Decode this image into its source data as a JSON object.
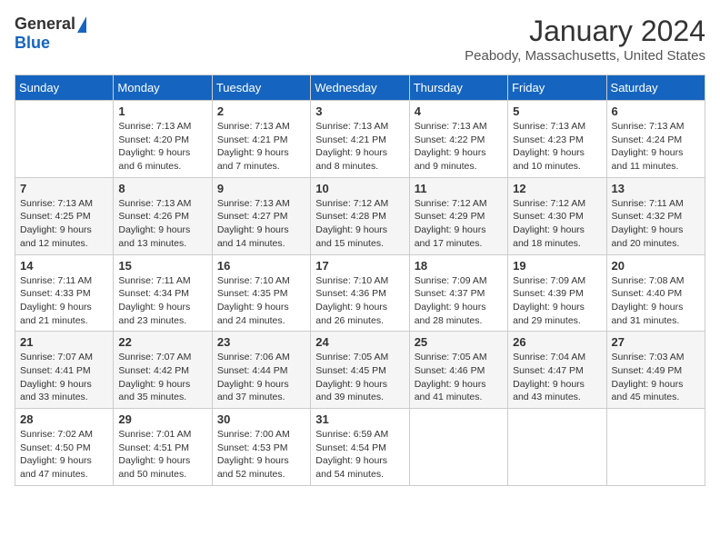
{
  "logo": {
    "general": "General",
    "blue": "Blue"
  },
  "header": {
    "title": "January 2024",
    "location": "Peabody, Massachusetts, United States"
  },
  "weekdays": [
    "Sunday",
    "Monday",
    "Tuesday",
    "Wednesday",
    "Thursday",
    "Friday",
    "Saturday"
  ],
  "weeks": [
    [
      {
        "day": "",
        "sunrise": "",
        "sunset": "",
        "daylight": ""
      },
      {
        "day": "1",
        "sunrise": "Sunrise: 7:13 AM",
        "sunset": "Sunset: 4:20 PM",
        "daylight": "Daylight: 9 hours and 6 minutes."
      },
      {
        "day": "2",
        "sunrise": "Sunrise: 7:13 AM",
        "sunset": "Sunset: 4:21 PM",
        "daylight": "Daylight: 9 hours and 7 minutes."
      },
      {
        "day": "3",
        "sunrise": "Sunrise: 7:13 AM",
        "sunset": "Sunset: 4:21 PM",
        "daylight": "Daylight: 9 hours and 8 minutes."
      },
      {
        "day": "4",
        "sunrise": "Sunrise: 7:13 AM",
        "sunset": "Sunset: 4:22 PM",
        "daylight": "Daylight: 9 hours and 9 minutes."
      },
      {
        "day": "5",
        "sunrise": "Sunrise: 7:13 AM",
        "sunset": "Sunset: 4:23 PM",
        "daylight": "Daylight: 9 hours and 10 minutes."
      },
      {
        "day": "6",
        "sunrise": "Sunrise: 7:13 AM",
        "sunset": "Sunset: 4:24 PM",
        "daylight": "Daylight: 9 hours and 11 minutes."
      }
    ],
    [
      {
        "day": "7",
        "sunrise": "Sunrise: 7:13 AM",
        "sunset": "Sunset: 4:25 PM",
        "daylight": "Daylight: 9 hours and 12 minutes."
      },
      {
        "day": "8",
        "sunrise": "Sunrise: 7:13 AM",
        "sunset": "Sunset: 4:26 PM",
        "daylight": "Daylight: 9 hours and 13 minutes."
      },
      {
        "day": "9",
        "sunrise": "Sunrise: 7:13 AM",
        "sunset": "Sunset: 4:27 PM",
        "daylight": "Daylight: 9 hours and 14 minutes."
      },
      {
        "day": "10",
        "sunrise": "Sunrise: 7:12 AM",
        "sunset": "Sunset: 4:28 PM",
        "daylight": "Daylight: 9 hours and 15 minutes."
      },
      {
        "day": "11",
        "sunrise": "Sunrise: 7:12 AM",
        "sunset": "Sunset: 4:29 PM",
        "daylight": "Daylight: 9 hours and 17 minutes."
      },
      {
        "day": "12",
        "sunrise": "Sunrise: 7:12 AM",
        "sunset": "Sunset: 4:30 PM",
        "daylight": "Daylight: 9 hours and 18 minutes."
      },
      {
        "day": "13",
        "sunrise": "Sunrise: 7:11 AM",
        "sunset": "Sunset: 4:32 PM",
        "daylight": "Daylight: 9 hours and 20 minutes."
      }
    ],
    [
      {
        "day": "14",
        "sunrise": "Sunrise: 7:11 AM",
        "sunset": "Sunset: 4:33 PM",
        "daylight": "Daylight: 9 hours and 21 minutes."
      },
      {
        "day": "15",
        "sunrise": "Sunrise: 7:11 AM",
        "sunset": "Sunset: 4:34 PM",
        "daylight": "Daylight: 9 hours and 23 minutes."
      },
      {
        "day": "16",
        "sunrise": "Sunrise: 7:10 AM",
        "sunset": "Sunset: 4:35 PM",
        "daylight": "Daylight: 9 hours and 24 minutes."
      },
      {
        "day": "17",
        "sunrise": "Sunrise: 7:10 AM",
        "sunset": "Sunset: 4:36 PM",
        "daylight": "Daylight: 9 hours and 26 minutes."
      },
      {
        "day": "18",
        "sunrise": "Sunrise: 7:09 AM",
        "sunset": "Sunset: 4:37 PM",
        "daylight": "Daylight: 9 hours and 28 minutes."
      },
      {
        "day": "19",
        "sunrise": "Sunrise: 7:09 AM",
        "sunset": "Sunset: 4:39 PM",
        "daylight": "Daylight: 9 hours and 29 minutes."
      },
      {
        "day": "20",
        "sunrise": "Sunrise: 7:08 AM",
        "sunset": "Sunset: 4:40 PM",
        "daylight": "Daylight: 9 hours and 31 minutes."
      }
    ],
    [
      {
        "day": "21",
        "sunrise": "Sunrise: 7:07 AM",
        "sunset": "Sunset: 4:41 PM",
        "daylight": "Daylight: 9 hours and 33 minutes."
      },
      {
        "day": "22",
        "sunrise": "Sunrise: 7:07 AM",
        "sunset": "Sunset: 4:42 PM",
        "daylight": "Daylight: 9 hours and 35 minutes."
      },
      {
        "day": "23",
        "sunrise": "Sunrise: 7:06 AM",
        "sunset": "Sunset: 4:44 PM",
        "daylight": "Daylight: 9 hours and 37 minutes."
      },
      {
        "day": "24",
        "sunrise": "Sunrise: 7:05 AM",
        "sunset": "Sunset: 4:45 PM",
        "daylight": "Daylight: 9 hours and 39 minutes."
      },
      {
        "day": "25",
        "sunrise": "Sunrise: 7:05 AM",
        "sunset": "Sunset: 4:46 PM",
        "daylight": "Daylight: 9 hours and 41 minutes."
      },
      {
        "day": "26",
        "sunrise": "Sunrise: 7:04 AM",
        "sunset": "Sunset: 4:47 PM",
        "daylight": "Daylight: 9 hours and 43 minutes."
      },
      {
        "day": "27",
        "sunrise": "Sunrise: 7:03 AM",
        "sunset": "Sunset: 4:49 PM",
        "daylight": "Daylight: 9 hours and 45 minutes."
      }
    ],
    [
      {
        "day": "28",
        "sunrise": "Sunrise: 7:02 AM",
        "sunset": "Sunset: 4:50 PM",
        "daylight": "Daylight: 9 hours and 47 minutes."
      },
      {
        "day": "29",
        "sunrise": "Sunrise: 7:01 AM",
        "sunset": "Sunset: 4:51 PM",
        "daylight": "Daylight: 9 hours and 50 minutes."
      },
      {
        "day": "30",
        "sunrise": "Sunrise: 7:00 AM",
        "sunset": "Sunset: 4:53 PM",
        "daylight": "Daylight: 9 hours and 52 minutes."
      },
      {
        "day": "31",
        "sunrise": "Sunrise: 6:59 AM",
        "sunset": "Sunset: 4:54 PM",
        "daylight": "Daylight: 9 hours and 54 minutes."
      },
      {
        "day": "",
        "sunrise": "",
        "sunset": "",
        "daylight": ""
      },
      {
        "day": "",
        "sunrise": "",
        "sunset": "",
        "daylight": ""
      },
      {
        "day": "",
        "sunrise": "",
        "sunset": "",
        "daylight": ""
      }
    ]
  ]
}
